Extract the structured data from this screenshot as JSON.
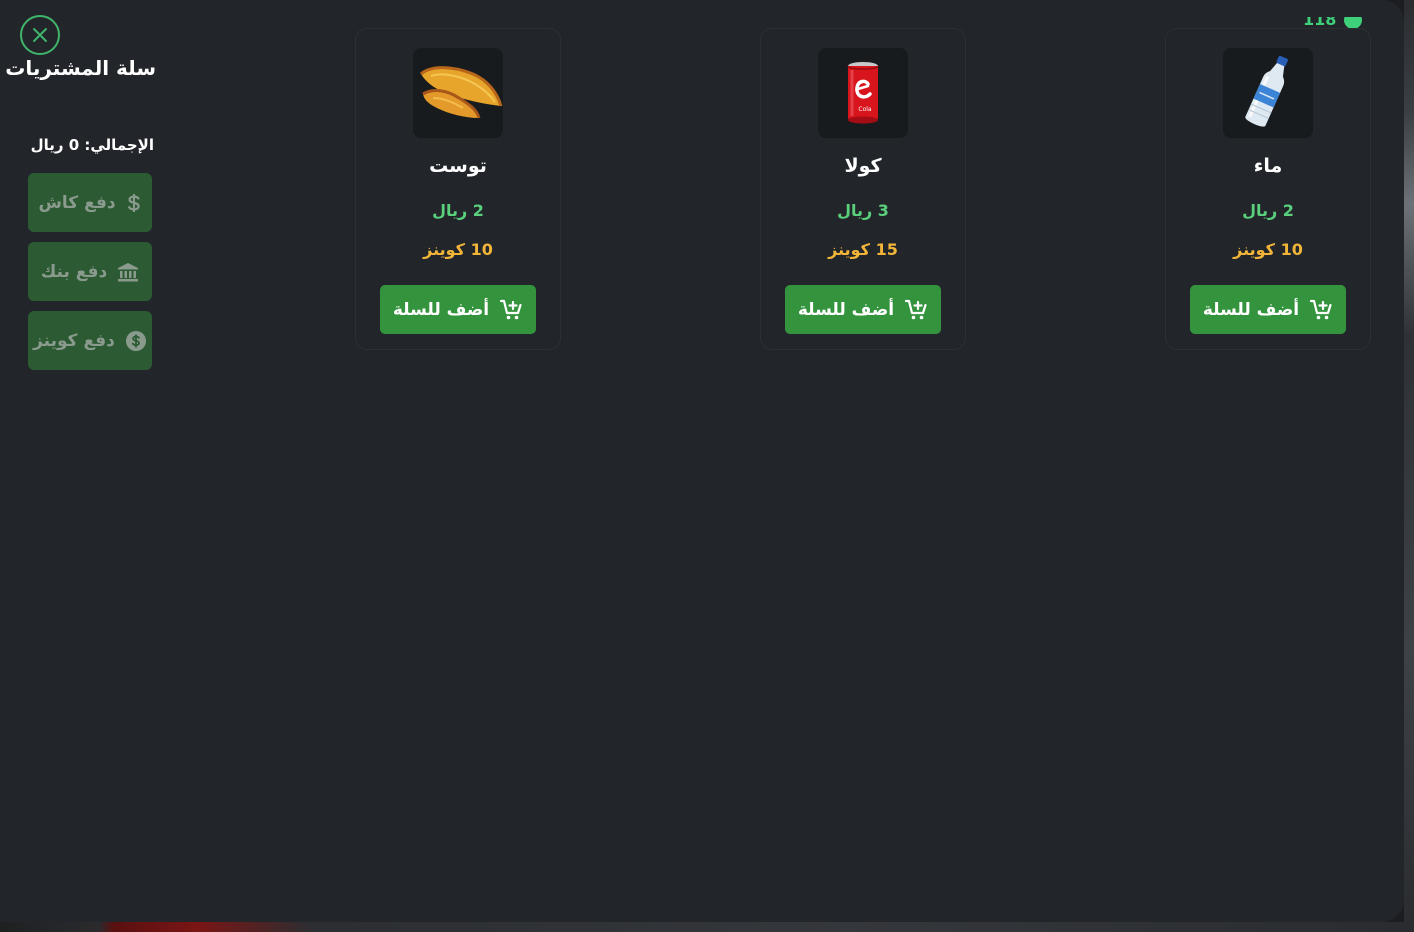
{
  "status": {
    "counter_text": "118"
  },
  "cart": {
    "title": "سلة المشتريات",
    "total_text": "الإجمالي: 0 ريال",
    "payments": [
      {
        "label": "دفع كاش",
        "icon": "dollar-icon"
      },
      {
        "label": "دفع بنك",
        "icon": "bank-icon"
      },
      {
        "label": "دفع كوينز",
        "icon": "coin-icon"
      }
    ]
  },
  "products": [
    {
      "name": "توست",
      "price": "2 ريال",
      "coins": "10 كوينز",
      "add_label": "أضف للسلة",
      "image": "toast-image"
    },
    {
      "name": "كولا",
      "price": "3 ريال",
      "coins": "15 كوينز",
      "add_label": "أضف للسلة",
      "image": "cola-can-image"
    },
    {
      "name": "ماء",
      "price": "2 ريال",
      "coins": "10 كوينز",
      "add_label": "أضف للسلة",
      "image": "water-bottle-image"
    }
  ],
  "colors": {
    "panel_bg": "#222529",
    "accent_green": "#34943e",
    "price_green": "#5ad07d",
    "coins_gold": "#f2b53a",
    "pay_button_bg": "#2b5a33"
  }
}
